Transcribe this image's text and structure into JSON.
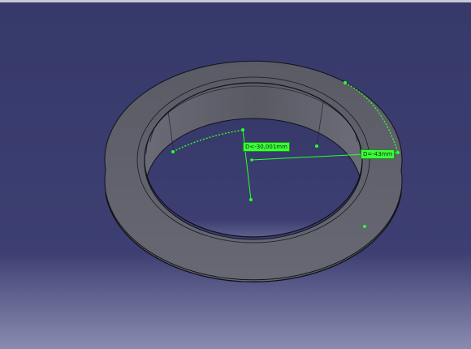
{
  "viewport": {
    "background_top": "#36396a",
    "background_bottom": "#7d7fa8"
  },
  "model": {
    "face_color": "#5d5e68",
    "edge_color": "#111118",
    "highlight_color": "#2cff2c"
  },
  "measurements": {
    "radius_label": "D<-30,001mm",
    "diameter_label": "D=-43mm"
  }
}
